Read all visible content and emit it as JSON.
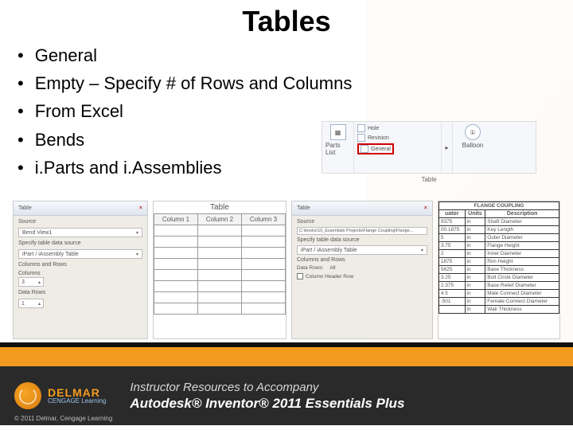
{
  "title": "Tables",
  "bullets": [
    "General",
    "Empty – Specify # of Rows and Columns",
    "From Excel",
    "Bends",
    "i.Parts and i.Assemblies"
  ],
  "ribbon": {
    "parts_list": "Parts List",
    "hole": "Hole",
    "revision": "Revision",
    "general": "General",
    "balloon": "Balloon",
    "caption": "Table"
  },
  "thumb1": {
    "header": "Table",
    "src_label": "Source",
    "bend_item": "Bend View1",
    "specify_label": "Specify table data source",
    "source_value": "iPart / iAssembly Table",
    "cols_rows_label": "Columns and Rows",
    "cols_label": "Columns",
    "cols_value": "3",
    "rows_label": "Data Rows",
    "rows_value": "1"
  },
  "thumb2": {
    "title": "Table",
    "cols": [
      "Column 1",
      "Column 2",
      "Column 3"
    ]
  },
  "thumb3": {
    "header": "Table",
    "src_label": "Source",
    "path": "C:\\books\\10_Essentials Projects\\Flange Coupling\\Flange...",
    "specify_label": "Specify table data source",
    "source_value": "iPart / iAssembly Table",
    "cols_rows_label": "Columns and Rows",
    "data_rows_label": "Data Rows:",
    "data_rows_value": "All",
    "header_row_label": "Column Header Row"
  },
  "thumb4": {
    "title": "FLANGE COUPLING",
    "headers": [
      "uator",
      "Units",
      "Description"
    ],
    "rows": [
      [
        "9375",
        "in",
        "Shaft Diameter"
      ],
      [
        "00.1875",
        "in",
        "Key Length"
      ],
      [
        "5",
        "in",
        "Outer Diameter"
      ],
      [
        "3.75",
        "in",
        "Flange Height"
      ],
      [
        "2",
        "in",
        "Inner Diameter"
      ],
      [
        "1875",
        "in",
        "Rim Height"
      ],
      [
        "5625",
        "in",
        "Base Thickness"
      ],
      [
        "3.25",
        "in",
        "Bolt Circle Diameter"
      ],
      [
        "2.375",
        "in",
        "Base Relief Diameter"
      ],
      [
        "4.5",
        "in",
        "Male Connect Diameter"
      ],
      [
        ".501",
        "in",
        "Female Connect Diameter"
      ],
      [
        "",
        "in",
        "Wall Thickness"
      ]
    ]
  },
  "footer": {
    "brand": "DELMAR",
    "brand_sub": "CENGAGE Learning",
    "copyright": "© 2011 Delmar, Cengage Learning",
    "line1": "Instructor Resources to Accompany",
    "line2": "Autodesk® Inventor® 2011 Essentials Plus",
    "autodesk": "Autodesk"
  }
}
